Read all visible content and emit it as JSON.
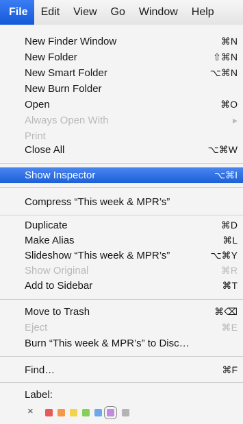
{
  "menubar": {
    "items": [
      "File",
      "Edit",
      "View",
      "Go",
      "Window",
      "Help"
    ]
  },
  "menu": {
    "items": [
      {
        "label": "New Finder Window",
        "shortcut": "⌘N"
      },
      {
        "label": "New Folder",
        "shortcut": "⇧⌘N"
      },
      {
        "label": "New Smart Folder",
        "shortcut": "⌥⌘N"
      },
      {
        "label": "New Burn Folder",
        "shortcut": ""
      },
      {
        "label": "Open",
        "shortcut": "⌘O"
      },
      {
        "label": "Always Open With",
        "shortcut": "▸"
      },
      {
        "label": "Print",
        "shortcut": ""
      },
      {
        "label": "Close All",
        "shortcut": "⌥⌘W"
      },
      {
        "label": "Show Inspector",
        "shortcut": "⌥⌘I"
      },
      {
        "label": "Compress “This week & MPR’s”",
        "shortcut": ""
      },
      {
        "label": "Duplicate",
        "shortcut": "⌘D"
      },
      {
        "label": "Make Alias",
        "shortcut": "⌘L"
      },
      {
        "label": "Slideshow “This week & MPR’s”",
        "shortcut": "⌥⌘Y"
      },
      {
        "label": "Show Original",
        "shortcut": "⌘R"
      },
      {
        "label": "Add to Sidebar",
        "shortcut": "⌘T"
      },
      {
        "label": "Move to Trash",
        "shortcut": "⌘⌫"
      },
      {
        "label": "Eject",
        "shortcut": "⌘E"
      },
      {
        "label": "Burn “This week & MPR’s” to Disc…",
        "shortcut": ""
      },
      {
        "label": "Find…",
        "shortcut": "⌘F"
      },
      {
        "label": "Label:",
        "shortcut": ""
      }
    ],
    "label_clear": "×",
    "label_colors": [
      "#e85a5a",
      "#f29a4a",
      "#f2d44a",
      "#86cf5a",
      "#6ea8ea",
      "#c28ae0",
      "#b4b4b4"
    ]
  }
}
